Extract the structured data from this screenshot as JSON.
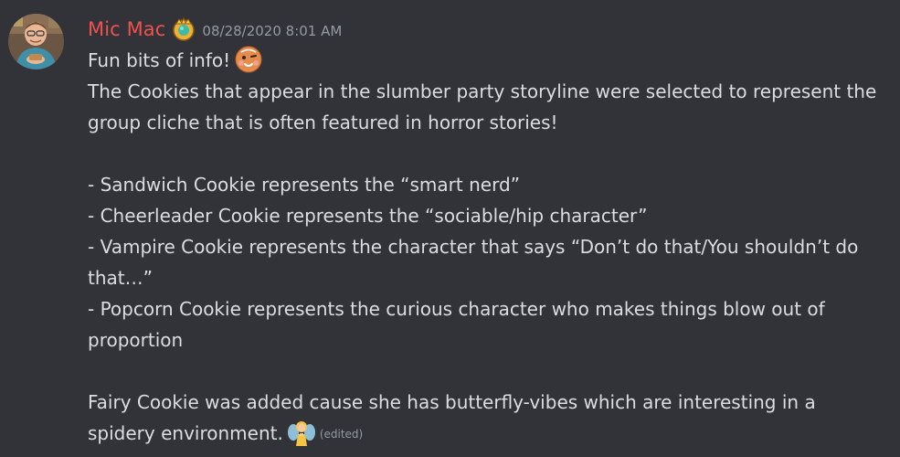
{
  "author": {
    "username": "Mic Mac",
    "username_color": "#f0514f",
    "badge_icon": "server-booster-crown-icon",
    "avatar_icon": "user-avatar-photo"
  },
  "timestamp": "08/28/2020 8:01 AM",
  "message": {
    "line1": "Fun bits of info!",
    "line1_emoji": "cookie-face-emoji",
    "para1": "The Cookies that appear in the slumber party storyline were selected to represent the group cliche that is often featured in horror stories!",
    "list": [
      "- Sandwich Cookie represents the “smart nerd”",
      "- Cheerleader Cookie represents the “sociable/hip character”",
      "- Vampire Cookie represents the character that says “Don’t do that/You shouldn’t do that…”",
      "- Popcorn Cookie represents the curious character who makes things blow out of proportion"
    ],
    "para2": "Fairy Cookie was added cause she has butterfly-vibes which are interesting in a spidery environment.",
    "para2_emoji": "fairy-emoji",
    "edited_label": "(edited)"
  },
  "colors": {
    "background": "#313338",
    "text": "#dbdee1",
    "muted": "#949ba4"
  }
}
